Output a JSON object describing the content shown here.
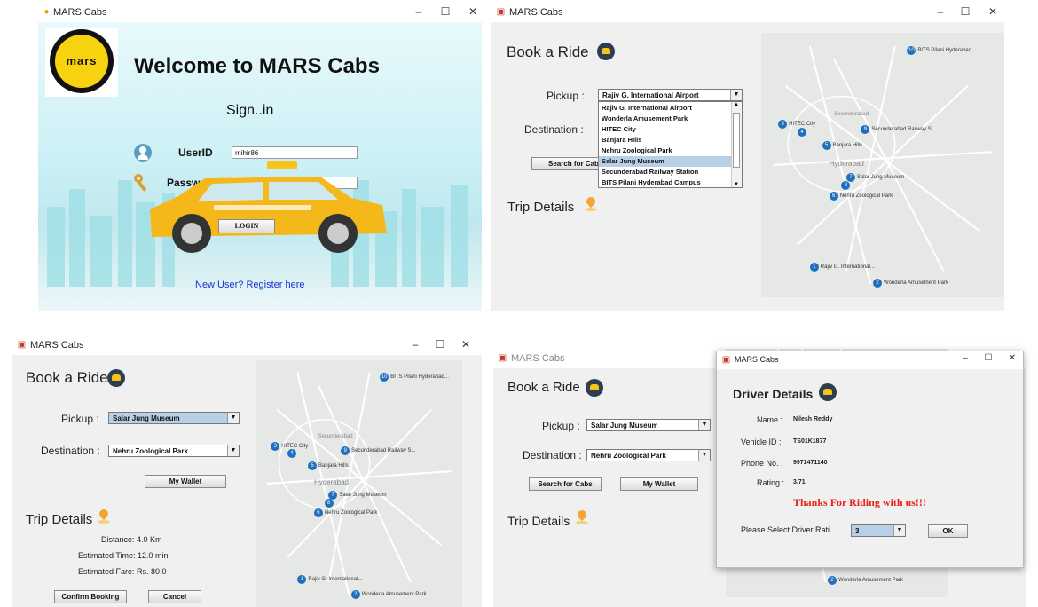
{
  "login": {
    "title": "MARS Cabs",
    "logo_text": "mars",
    "welcome": "Welcome to MARS Cabs",
    "signin": "Sign..in",
    "userid_label": "UserID",
    "userid_value": "mihir86",
    "password_label": "Password",
    "password_value": "•••••",
    "login_button": "LOGIN",
    "register_link": "New User? Register here"
  },
  "book": {
    "title": "MARS Cabs",
    "heading": "Book a Ride",
    "pickup_label": "Pickup :",
    "pickup_value": "Rajiv G. International Airport",
    "destination_label": "Destination :",
    "search_button": "Search for Cabs",
    "trip_details": "Trip Details",
    "dropdown_options": [
      "Rajiv G. International Airport",
      "Wonderla Amusement Park",
      "HITEC City",
      "Banjara Hills",
      "Nehru Zoological Park",
      "Salar Jung Museum",
      "Secunderabad Railway Station",
      "BITS Pilani Hyderabad Campus"
    ],
    "highlighted_option": "Salar Jung Museum"
  },
  "map_pins": [
    {
      "n": "10",
      "label": "BITS Pilani Hyderabad..."
    },
    {
      "n": "3",
      "label": "HITEC City"
    },
    {
      "n": "4",
      "label": ""
    },
    {
      "n": "9",
      "label": "Secunderabad Railway S..."
    },
    {
      "n": "5",
      "label": "Banjara Hills"
    },
    {
      "n": "7",
      "label": "Salar Jung Museum"
    },
    {
      "n": "8",
      "label": ""
    },
    {
      "n": "6",
      "label": "Nehru Zoological Park"
    },
    {
      "n": "1",
      "label": "Rajiv G. International..."
    },
    {
      "n": "2",
      "label": "Wonderla Amusement Park"
    }
  ],
  "map_text": {
    "secunderabad": "Secunderabad",
    "hyderabad": "Hyderabad"
  },
  "trip": {
    "title": "MARS Cabs",
    "heading": "Book a Ride",
    "pickup_label": "Pickup :",
    "pickup_value": "Salar Jung Museum",
    "destination_label": "Destination :",
    "destination_value": "Nehru Zoological Park",
    "wallet_button": "My Wallet",
    "trip_details": "Trip Details",
    "distance": "Distance: 4.0 Km",
    "time": "Estimated Time: 12.0 min",
    "fare": "Estimated Fare: Rs. 80.0",
    "confirm_button": "Confirm Booking",
    "cancel_button": "Cancel"
  },
  "driver_bg": {
    "title": "MARS Cabs",
    "heading": "Book a Ride",
    "pickup_label": "Pickup :",
    "pickup_value": "Salar Jung Museum",
    "destination_label": "Destination :",
    "destination_value": "Nehru Zoological Park",
    "search_button": "Search for Cabs",
    "wallet_button": "My Wallet",
    "trip_details": "Trip Details"
  },
  "driver": {
    "title": "MARS Cabs",
    "heading": "Driver Details",
    "name_label": "Name :",
    "name_value": "Nilesh Reddy",
    "vehicle_label": "Vehicle ID :",
    "vehicle_value": "TS01K1877",
    "phone_label": "Phone No. :",
    "phone_value": "9971471140",
    "rating_label": "Rating :",
    "rating_value": "3.71",
    "thanks": "Thanks For Riding with us!!!",
    "select_label": "Please Select Driver Rati...",
    "select_value": "3",
    "ok_button": "OK"
  },
  "window_controls": {
    "min": "–",
    "max": "☐",
    "close": "✕"
  }
}
